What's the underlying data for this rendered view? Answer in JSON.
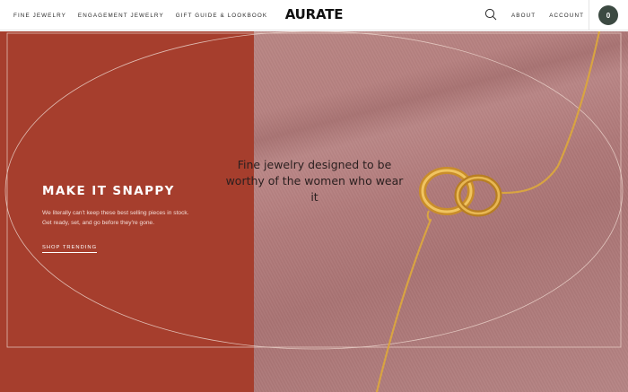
{
  "header": {
    "nav_left": [
      {
        "label": "FINE JEWELRY"
      },
      {
        "label": "ENGAGEMENT JEWELRY"
      },
      {
        "label": "GIFT GUIDE & LOOKBOOK"
      }
    ],
    "logo": "AURATE",
    "search_icon": "search-icon",
    "nav_right": [
      {
        "label": "ABOUT"
      },
      {
        "label": "ACCOUNT"
      }
    ],
    "cart_count": "0"
  },
  "hero": {
    "title": "MAKE IT SNAPPY",
    "description": "We literally can't keep these best selling pieces in stock. Get ready, set, and go before they're gone.",
    "cta_label": "SHOP TRENDING",
    "tagline": "Fine jewelry designed to be worthy of the women who wear it",
    "colors": {
      "panel": "#a63e2d",
      "fabric": "#b47d7d",
      "gold": "#d9a441",
      "cart_badge": "#3c4a42"
    }
  }
}
